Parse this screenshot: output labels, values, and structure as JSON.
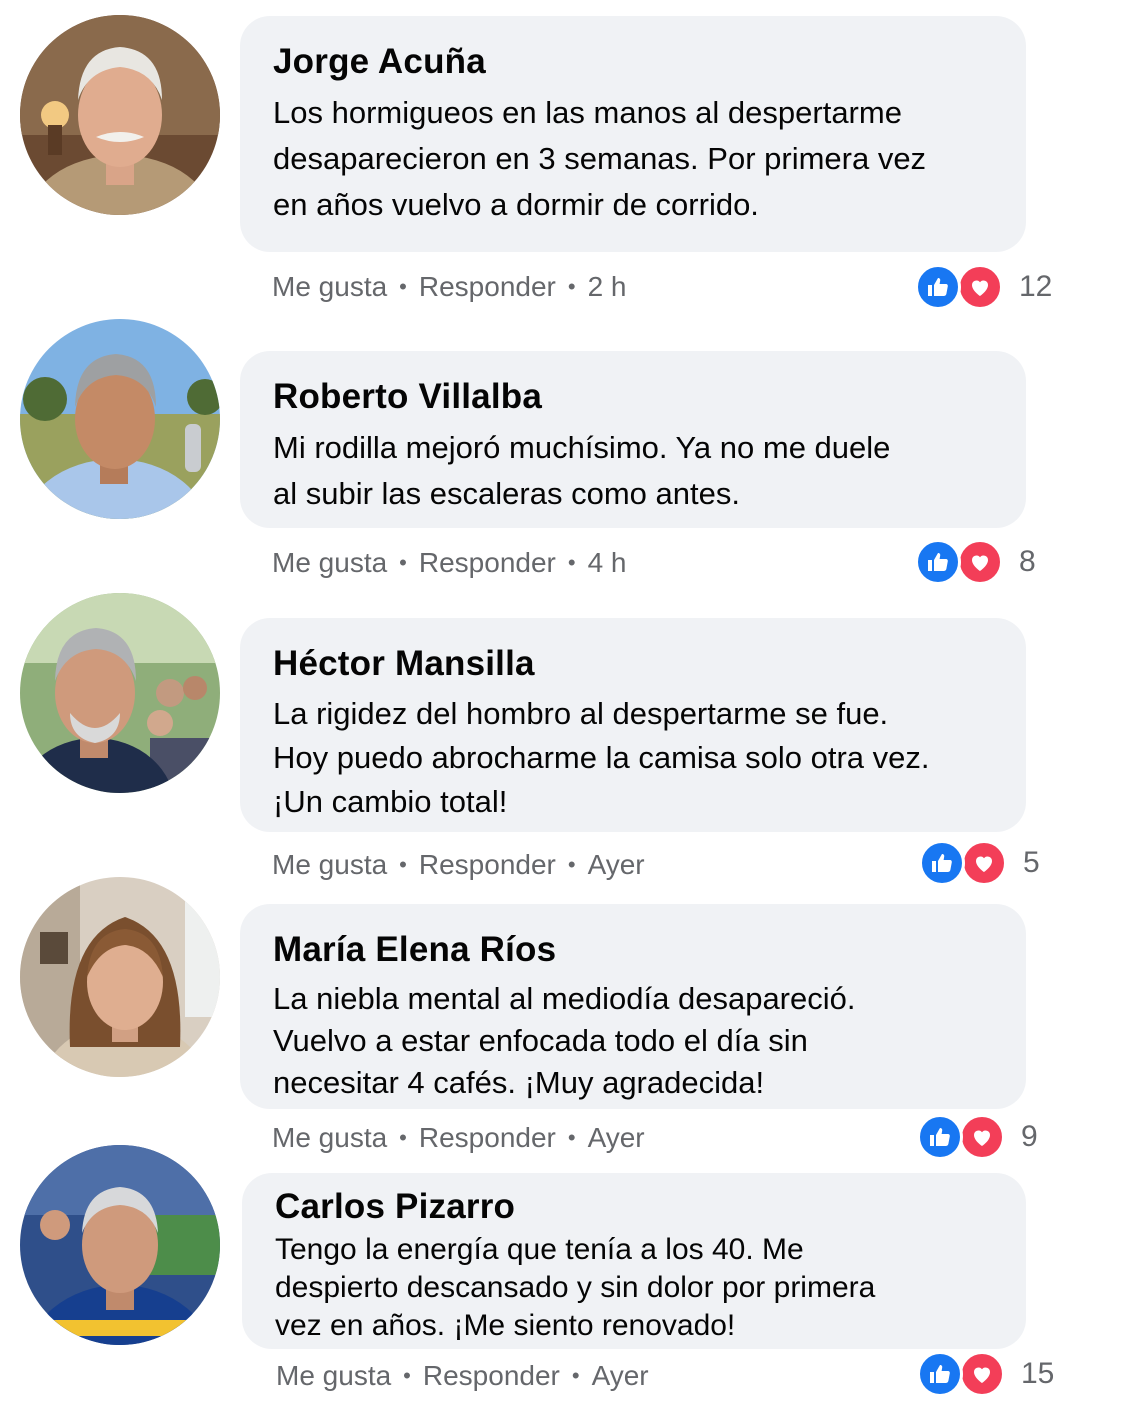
{
  "comments": [
    {
      "author": "Jorge Acuña",
      "lines": [
        "Los hormigueos en las manos al despertarme",
        "desaparecieron en 3 semanas. Por primera vez",
        "en años vuelvo a dormir de corrido."
      ],
      "like_label": "Me gusta",
      "reply_label": "Responder",
      "time": "2 h",
      "reactions": [
        "like-icon",
        "love-icon"
      ],
      "reaction_count": "12"
    },
    {
      "author": "Roberto Villalba",
      "lines": [
        "Mi rodilla mejoró muchísimo. Ya no me duele",
        "al subir las escaleras como antes."
      ],
      "like_label": "Me gusta",
      "reply_label": "Responder",
      "time": "4 h",
      "reactions": [
        "like-icon",
        "love-icon"
      ],
      "reaction_count": "8"
    },
    {
      "author": "Héctor Mansilla",
      "lines": [
        "La rigidez del hombro al despertarme se fue.",
        "Hoy puedo abrocharme la camisa solo otra vez.",
        "¡Un cambio total!"
      ],
      "like_label": "Me gusta",
      "reply_label": "Responder",
      "time": "Ayer",
      "reactions": [
        "like-icon",
        "love-icon"
      ],
      "reaction_count": "5"
    },
    {
      "author": "María Elena Ríos",
      "lines": [
        "La niebla mental al mediodía desapareció.",
        "Vuelvo a estar enfocada todo el día sin",
        "necesitar 4 cafés. ¡Muy agradecida!"
      ],
      "like_label": "Me gusta",
      "reply_label": "Responder",
      "time": "Ayer",
      "reactions": [
        "like-icon",
        "love-icon"
      ],
      "reaction_count": "9"
    },
    {
      "author": "Carlos Pizarro",
      "lines": [
        "Tengo la energía que tenía a los 40. Me",
        "despierto descansado y sin dolor por primera",
        "vez en años. ¡Me siento renovado!"
      ],
      "like_label": "Me gusta",
      "reply_label": "Responder",
      "time": "Ayer",
      "reactions": [
        "like-icon",
        "love-icon"
      ],
      "reaction_count": "15"
    }
  ],
  "colors": {
    "bubble": "#f0f2f5",
    "meta_text": "#65676b",
    "like": "#1877f2",
    "love": "#f33e58"
  }
}
